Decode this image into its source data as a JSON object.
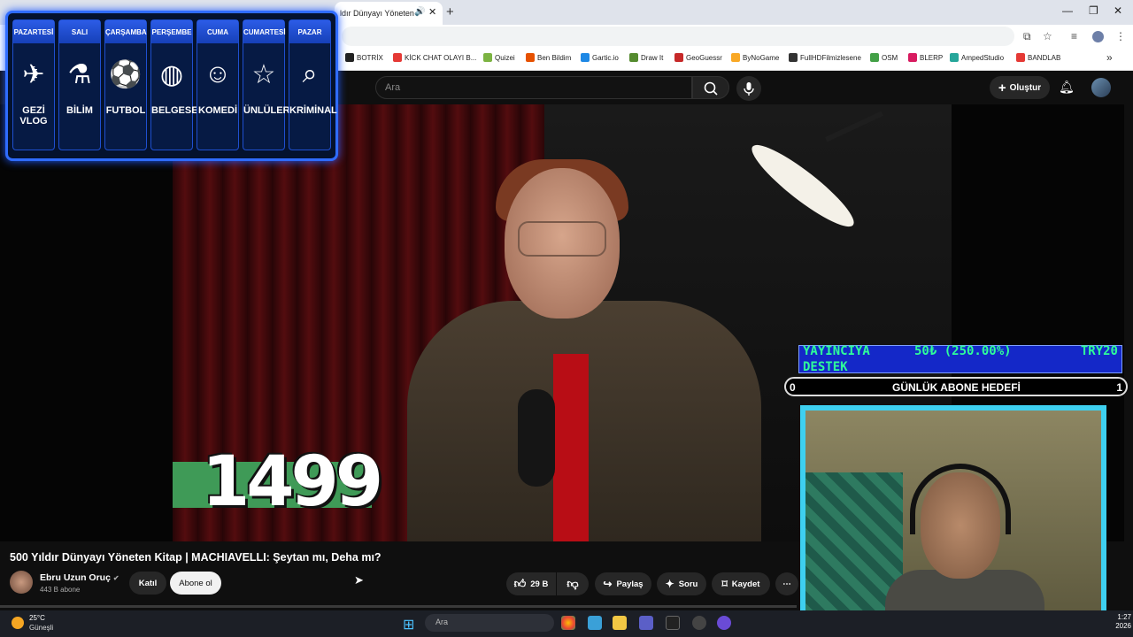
{
  "browser": {
    "tab_title": "ldır Dünyayı Yöneten",
    "bookmarks": [
      {
        "label": "BOTRİX",
        "color": "#222222"
      },
      {
        "label": "KİCK CHAT OLAYI B...",
        "color": "#e53935"
      },
      {
        "label": "Quizei",
        "color": "#7cb342"
      },
      {
        "label": "Ben Bildim",
        "color": "#e65100"
      },
      {
        "label": "Gartic.io",
        "color": "#1e88e5"
      },
      {
        "label": "Draw It",
        "color": "#558b2f"
      },
      {
        "label": "GeoGuessr",
        "color": "#c62828"
      },
      {
        "label": "ByNoGame",
        "color": "#f9a825"
      },
      {
        "label": "FullHDFilmizlesene",
        "color": "#333333"
      },
      {
        "label": "OSM",
        "color": "#43a047"
      },
      {
        "label": "BLERP",
        "color": "#d81b60"
      },
      {
        "label": "AmpedStudio",
        "color": "#26a69a"
      },
      {
        "label": "BANDLAB",
        "color": "#e53935"
      }
    ]
  },
  "youtube": {
    "search_placeholder": "Ara",
    "create_label": "Oluştur"
  },
  "video": {
    "counter": "1499",
    "title": "500 Yıldır Dünyayı Yöneten Kitap | MACHIAVELLI: Şeytan mı, Deha mı?",
    "channel_name": "Ebru Uzun Oruç",
    "subscribers": "443 B abone",
    "join_label": "Katıl",
    "subscribe_label": "Abone ol",
    "likes": "29 B",
    "share_label": "Paylaş",
    "ask_label": "Soru",
    "save_label": "Kaydet"
  },
  "schedule": [
    {
      "day": "PAZARTESİ",
      "genre": "GEZİ VLOG",
      "icon": "globe-plane-icon",
      "glyph": "✈"
    },
    {
      "day": "SALI",
      "genre": "BİLİM",
      "icon": "science-icon",
      "glyph": "⚗"
    },
    {
      "day": "ÇARŞAMBA",
      "genre": "FUTBOL",
      "icon": "football-icon",
      "glyph": "⚽"
    },
    {
      "day": "PERŞEMBE",
      "genre": "BELGESEL",
      "icon": "globe-icon",
      "glyph": "◍"
    },
    {
      "day": "CUMA",
      "genre": "KOMEDİ",
      "icon": "theater-mask-icon",
      "glyph": "☺"
    },
    {
      "day": "CUMARTESİ",
      "genre": "ÜNLÜLER",
      "icon": "star-icon",
      "glyph": "☆"
    },
    {
      "day": "PAZAR",
      "genre": "KRİMİNAL",
      "icon": "magnifier-fingerprint-icon",
      "glyph": "⌕"
    }
  ],
  "donation": {
    "label_line1": "YAYINCIYA",
    "label_line2": "DESTEK",
    "progress": "50₺ (250.00%)",
    "goal": "TRY20"
  },
  "sub_goal": {
    "current": "0",
    "label": "GÜNLÜK ABONE HEDEFİ",
    "target": "1"
  },
  "taskbar": {
    "temp": "25°C",
    "weather": "Güneşli",
    "search_placeholder": "Ara",
    "time": "1:27",
    "date": "2026"
  },
  "colors": {
    "accent_blue": "#2f6cff",
    "webcam_border": "#3ed0f0",
    "donation_text": "#2fff9a"
  }
}
